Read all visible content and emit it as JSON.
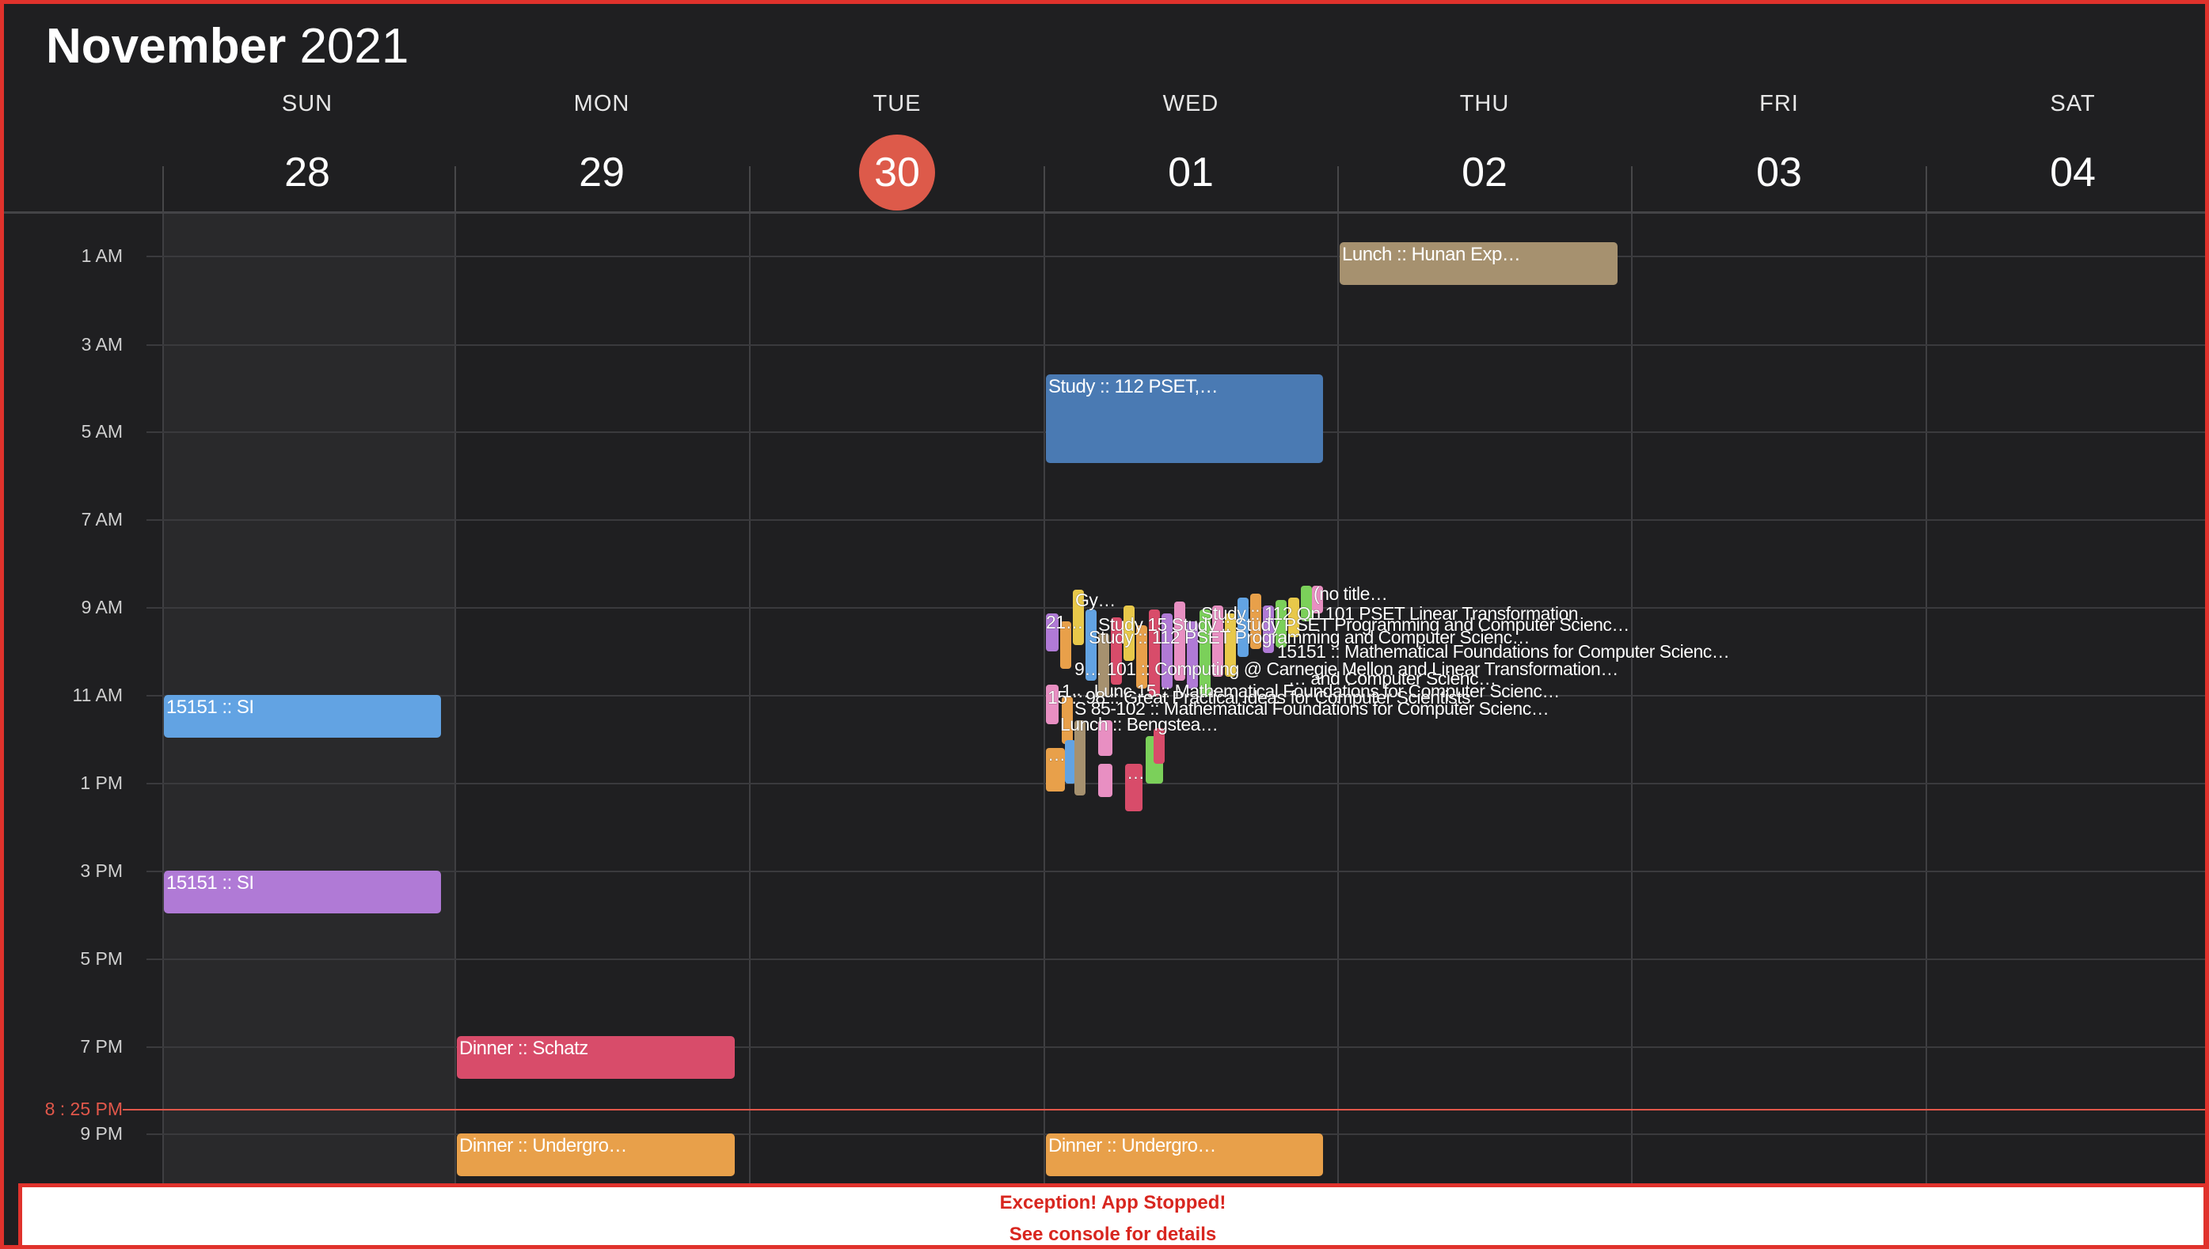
{
  "header": {
    "month": "November",
    "year": "2021"
  },
  "days": [
    {
      "name": "SUN",
      "num": "28"
    },
    {
      "name": "MON",
      "num": "29"
    },
    {
      "name": "TUE",
      "num": "30",
      "today": true
    },
    {
      "name": "WED",
      "num": "01"
    },
    {
      "name": "THU",
      "num": "02"
    },
    {
      "name": "FRI",
      "num": "03"
    },
    {
      "name": "SAT",
      "num": "04"
    }
  ],
  "hour_labels": [
    "1 AM",
    "3 AM",
    "5 AM",
    "7 AM",
    "9 AM",
    "11 AM",
    "1 PM",
    "3 PM",
    "5 PM",
    "7 PM",
    "9 PM"
  ],
  "now_label": "8 : 25  PM",
  "events": [
    {
      "title": "Lunch :: Hunan Exp…",
      "color": "#a6916f"
    },
    {
      "title": "Study :: 112 PSET,…",
      "color": "#4a7ab3"
    },
    {
      "title": "15151 :: SI",
      "color": "#62a3e3"
    },
    {
      "title": "15151 :: SI",
      "color": "#b07ad6"
    },
    {
      "title": "Dinner :: Schatz",
      "color": "#d84c6a"
    },
    {
      "title": "Dinner :: Undergro…",
      "color": "#e8a04a"
    },
    {
      "title": "Dinner :: Undergro…",
      "color": "#e8a04a"
    }
  ],
  "overlap_texts": [
    "(no title…",
    "Gy…",
    "21…",
    "Study :: 112 On 101 PSET Linear Transformation",
    "Study 15 Study :: Study PSET Programming and Computer Scienc…",
    "Study :: 112 PSET Programming and Computer Scienc…",
    "15151 :: Mathematical Foundations for Computer Scienc…",
    "9… 101 :: Computing @ Carnegie Mellon and Linear Transformation…",
    "… and Computer Scienc…",
    "1… Lunc 15 :: Mathematical Foundations for Computer Scienc…",
    "15 :: 98 :: Great Practical Ideas for Computer Scientists",
    "S 85-102 :: Mathematical Foundations for Computer Scienc…",
    "Lunch :: Bengstea…",
    "…",
    "…"
  ],
  "error": {
    "title": "Exception! App Stopped!",
    "detail": "See console for details"
  }
}
